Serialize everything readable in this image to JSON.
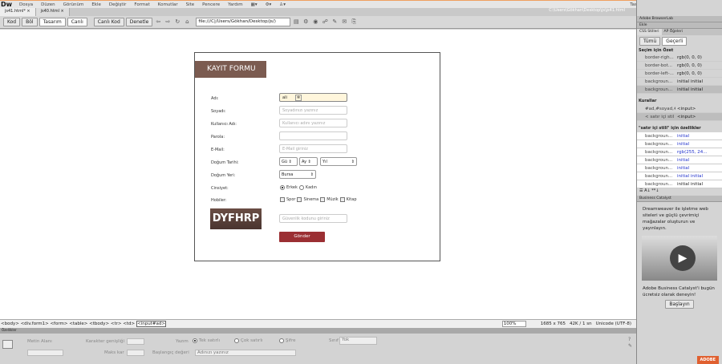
{
  "menu": {
    "logo": "Dw",
    "items": [
      "Dosya",
      "Düzen",
      "Görünüm",
      "Ekle",
      "Değiştir",
      "Format",
      "Komutlar",
      "Site",
      "Pencere",
      "Yardım"
    ],
    "workspace": "Tasarımcı"
  },
  "tabs": [
    "js41.html*",
    "js40.html"
  ],
  "file_path": "C:\\Users\\Gökhan\\Desktop\\js\\js41.html",
  "toolbar": {
    "kod": "Kod",
    "bol": "Böl",
    "tasarim": "Tasarım",
    "canli": "Canlı",
    "canli_kod": "Canlı Kod",
    "denetle": "Denetle",
    "address": "file:///C|/Users/Gökhan/Desktop/js/)"
  },
  "form": {
    "title": "KAYIT FORMU",
    "labels": [
      "Adı:",
      "Soyadı:",
      "Kullanıcı Adı:",
      "Parola:",
      "E-Mail:",
      "Doğum Tarihi:",
      "Doğum Yeri:",
      "Cinsiyet:",
      "Hobiler:"
    ],
    "ad_value": "ali",
    "soyad_ph": "Soyadınızı yazınız",
    "kullanici_ph": "Kullanıcı adını yazınız",
    "email_ph": "E-Mail giriniz",
    "gun": "Gü",
    "ay": "Ay",
    "yil": "Yıl",
    "dogum_yeri": "Bursa",
    "genders": [
      "Erkek",
      "Kadın"
    ],
    "hobbies": [
      "Spor",
      "Sinema",
      "Müzik",
      "Kitap"
    ],
    "captcha": "DYFHRP",
    "guvenlik_ph": "Güvenlik kodunu giriniz",
    "submit": "Gönder"
  },
  "status": {
    "tags": "<body> <div.form1> <form> <table> <tbody> <tr> <td>",
    "selected_tag": "<input#ad>",
    "zoom": "100%",
    "size": "1685 x 765",
    "weight": "42K / 1 sn",
    "encoding": "Unicode (UTF-8)"
  },
  "props": {
    "title": "Özellikler",
    "metin_alani": "Metin Alanı",
    "karakter": "Karakter genişliği",
    "maks": "Maks kar",
    "yazim": "Yazım",
    "tek": "Tek satırlı",
    "cok": "Çok satırlı",
    "sifre": "Şifre",
    "baslangic": "Başlangıç değeri",
    "baslangic_val": "Adınızı yazınız",
    "sinif": "Sınıf",
    "sinif_val": "Yok"
  },
  "right": {
    "browserlab": "Adobe BrowserLab",
    "ekle": "Ekle",
    "css_tab": "CSS Stilleri",
    "ap_tab": "AP Öğeleri",
    "tumu": "Tümü",
    "gecerli": "Geçerli",
    "summary": "Seçim için Özet",
    "summary_rows": [
      [
        "border-righ...",
        "rgb(0, 0, 0)"
      ],
      [
        "border-bot...",
        "rgb(0, 0, 0)"
      ],
      [
        "border-left-...",
        "rgb(0, 0, 0)"
      ],
      [
        "backgroun...",
        "initial initial"
      ],
      [
        "backgroun...",
        "initial initial"
      ]
    ],
    "kurallar": "Kurallar",
    "rules": [
      [
        "#ad,#soyad,#ka...",
        "<input>"
      ],
      [
        "< satır içi stil >",
        "<input>"
      ]
    ],
    "props_title": "\"satır içi stili\" için özellikler",
    "prop_rows": [
      [
        "backgroun...",
        "initial"
      ],
      [
        "backgroun...",
        "initial"
      ],
      [
        "backgroun...",
        "rgb(255, 24..."
      ],
      [
        "backgroun...",
        "initial"
      ],
      [
        "backgroun...",
        "initial"
      ],
      [
        "backgroun...",
        "initial initial"
      ],
      [
        "backgroun...",
        "initial initial"
      ]
    ],
    "bc_title": "Business Catalyst",
    "bc_text": "Dreamweaver ile işletme web siteleri ve güçlü çevrimiçi mağazalar oluşturun ve yayınlayın.",
    "bc_text2": "Adobe Business Catalyst'i bugün ücretsiz olarak deneyin!",
    "baslayin": "Başlayın",
    "adobe": "ADOBE"
  }
}
